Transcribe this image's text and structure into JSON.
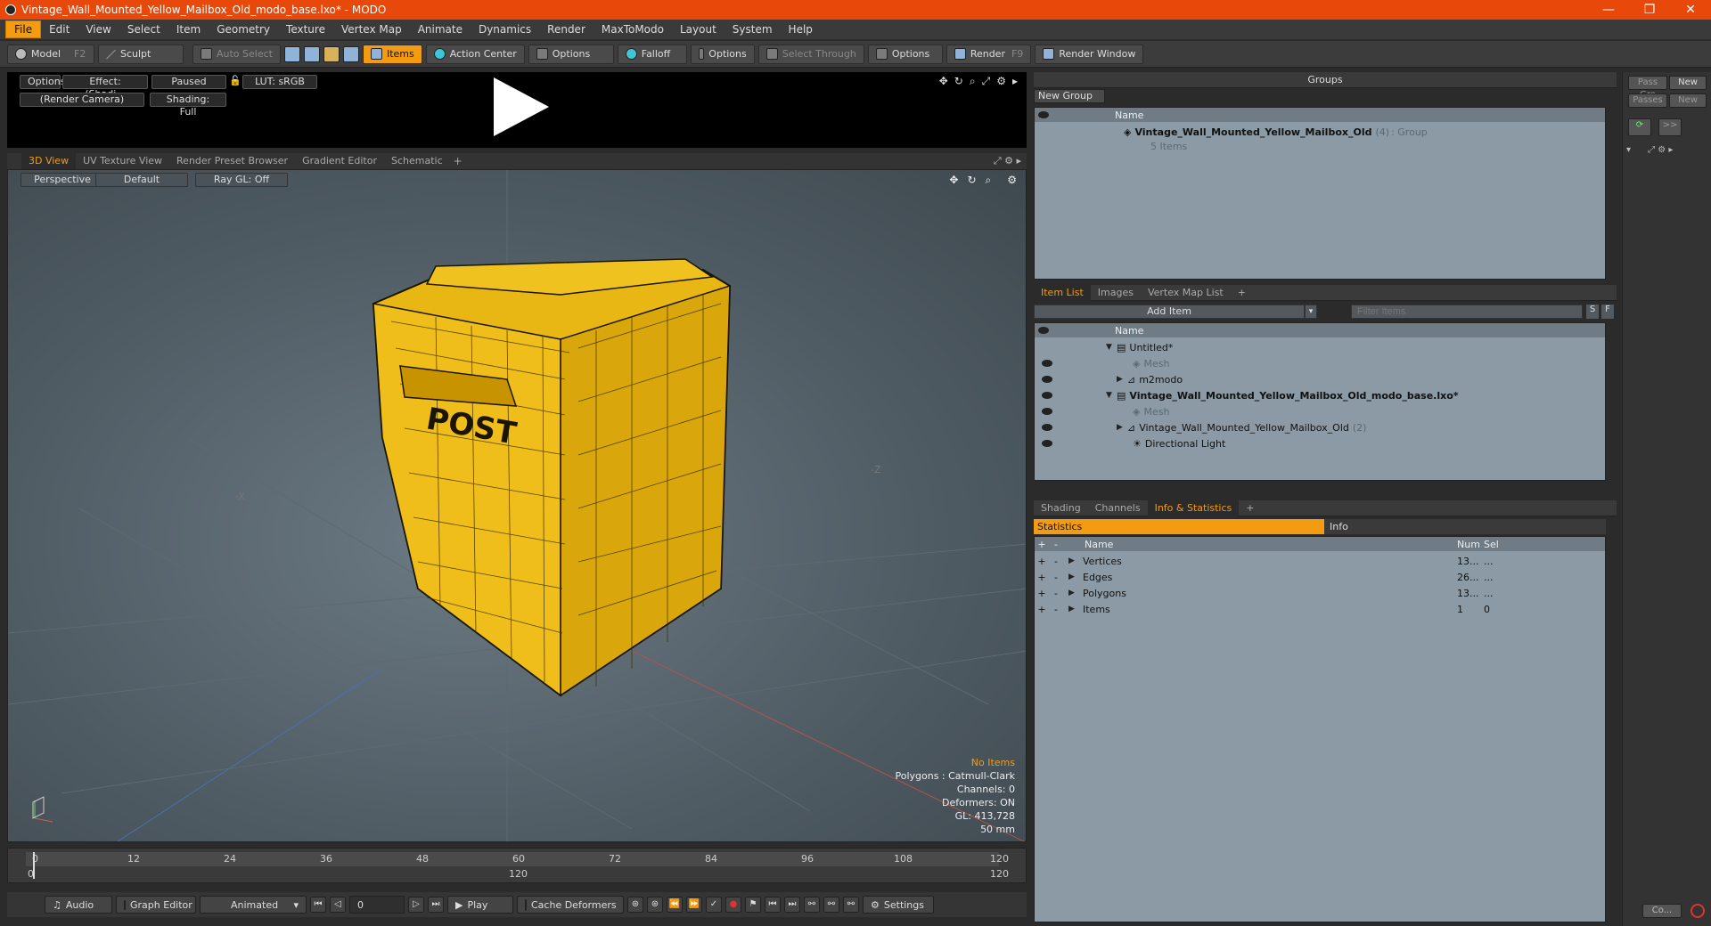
{
  "window": {
    "title": "Vintage_Wall_Mounted_Yellow_Mailbox_Old_modo_base.lxo* - MODO",
    "minimize": "—",
    "maximize": "❐",
    "close": "✕"
  },
  "menu": [
    "File",
    "Edit",
    "View",
    "Select",
    "Item",
    "Geometry",
    "Texture",
    "Vertex Map",
    "Animate",
    "Dynamics",
    "Render",
    "MaxToModo",
    "Layout",
    "System",
    "Help"
  ],
  "toolbar": {
    "model": "Model",
    "model_hotkey": "F2",
    "sculpt": "Sculpt",
    "auto_select": "Auto Select",
    "items": "Items",
    "action_center": "Action Center",
    "options1": "Options",
    "falloff": "Falloff",
    "options2": "Options",
    "select_through": "Select Through",
    "options3": "Options",
    "render": "Render",
    "render_hotkey": "F9",
    "render_window": "Render Window"
  },
  "preview": {
    "options": "Options",
    "effect": "Effect: (Shadi...",
    "paused": "Paused",
    "lut": "LUT: sRGB",
    "camera": "(Render Camera)",
    "shading": "Shading: Full"
  },
  "view_tabs": [
    "3D View",
    "UV Texture View",
    "Render Preset Browser",
    "Gradient Editor",
    "Schematic"
  ],
  "viewport": {
    "projection": "Perspective",
    "style": "Default",
    "raygl": "Ray GL: Off",
    "hud": [
      "No Items",
      "Polygons : Catmull-Clark",
      "Channels: 0",
      "Deformers: ON",
      "GL: 413,728",
      "50 mm"
    ],
    "axis_x": "-X",
    "axis_z": "-Z",
    "mesh_label": "POST",
    "mesh_color": "#e8b713"
  },
  "timeline": {
    "ticks": [
      "0",
      "12",
      "24",
      "36",
      "48",
      "60",
      "72",
      "84",
      "96",
      "108",
      "120"
    ],
    "sub": {
      "start": "0",
      "mid": "120",
      "end": "120"
    }
  },
  "transport": {
    "audio": "Audio",
    "graph_editor": "Graph Editor",
    "animated": "Animated",
    "frame": "0",
    "play": "Play",
    "cache_deformers": "Cache Deformers",
    "settings": "Settings"
  },
  "groups": {
    "title": "Groups",
    "new_group": "New Group",
    "col_name": "Name",
    "item_name": "Vintage_Wall_Mounted_Yellow_Mailbox_Old",
    "item_count": "(4)",
    "item_type": ": Group",
    "item_sub": "5 Items"
  },
  "item_list": {
    "tabs": [
      "Item List",
      "Images",
      "Vertex Map List"
    ],
    "add_item": "Add Item",
    "filter_placeholder": "Filter Items",
    "s": "S",
    "f": "F",
    "col_name": "Name",
    "rows": [
      {
        "label": "Untitled*",
        "bold": false
      },
      {
        "label": "Mesh",
        "bold": false,
        "muted": true
      },
      {
        "label": "m2modo",
        "bold": false
      },
      {
        "label": "Vintage_Wall_Mounted_Yellow_Mailbox_Old_modo_base.lxo*",
        "bold": true
      },
      {
        "label": "Mesh",
        "bold": false,
        "muted": true
      },
      {
        "label": "Vintage_Wall_Mounted_Yellow_Mailbox_Old",
        "suffix": "(2)",
        "bold": false
      },
      {
        "label": "Directional Light",
        "bold": false
      }
    ]
  },
  "stats": {
    "tabs": [
      "Shading",
      "Channels",
      "Info & Statistics"
    ],
    "sub_tabs": [
      "Statistics",
      "Info"
    ],
    "cols": {
      "name": "Name",
      "num": "Num",
      "sel": "Sel"
    },
    "rows": [
      {
        "name": "Vertices",
        "num": "13...",
        "sel": "..."
      },
      {
        "name": "Edges",
        "num": "26...",
        "sel": "..."
      },
      {
        "name": "Polygons",
        "num": "13...",
        "sel": "..."
      },
      {
        "name": "Items",
        "num": "1",
        "sel": "0"
      }
    ]
  },
  "farright": {
    "pass_group": "Pass Gro",
    "passes": "Passes",
    "new1": "New",
    "new2": "New",
    "more": ">>",
    "co": "Co..."
  }
}
